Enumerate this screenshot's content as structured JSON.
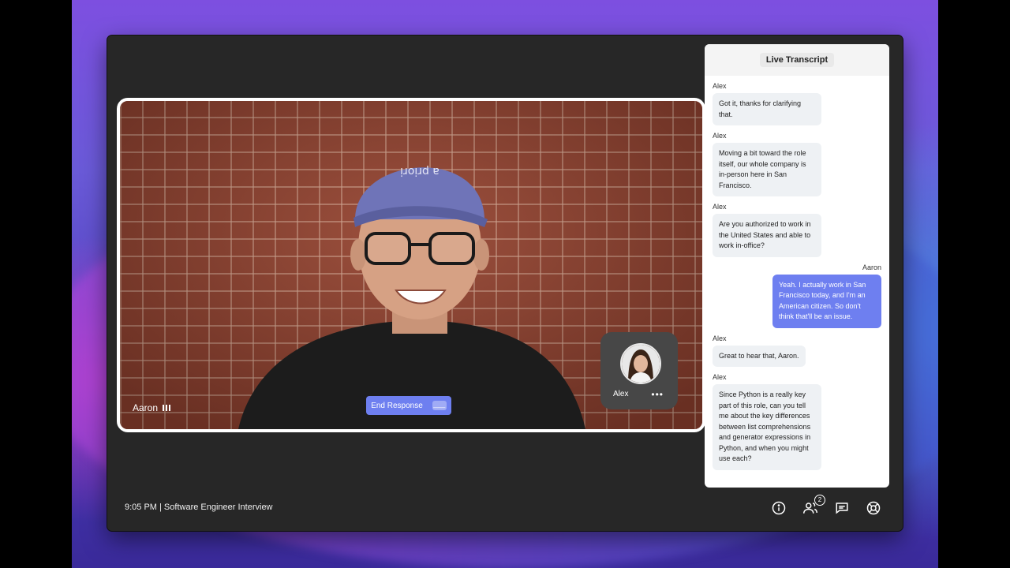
{
  "call": {
    "footer_text": "9:05 PM | Software Engineer Interview",
    "main_participant": "Aaron",
    "pip_participant": "Alex",
    "end_response_label": "End Response",
    "end_response_key": "___",
    "pip_more": "•••"
  },
  "transcript": {
    "title": "Live Transcript",
    "messages": [
      {
        "speaker": "Alex",
        "text": "Got it, thanks for clarifying that.",
        "side": "left"
      },
      {
        "speaker": "Alex",
        "text": "Moving a bit toward the role itself, our whole company is in-person here in San Francisco.",
        "side": "left"
      },
      {
        "speaker": "Alex",
        "text": "Are you authorized to work in the United States and able to work in-office?",
        "side": "left"
      },
      {
        "speaker": "Aaron",
        "text": "Yeah. I actually work in San Francisco today, and I'm an American citizen. So don't think that'll be an issue.",
        "side": "right"
      },
      {
        "speaker": "Alex",
        "text": "Great to hear that, Aaron.",
        "side": "left"
      },
      {
        "speaker": "Alex",
        "text": "Since Python is a really key part of this role, can you tell me about the key differences between list comprehensions and generator expressions in Python, and when you might use each?",
        "side": "left"
      }
    ]
  },
  "toolbar": {
    "participants_count": "2",
    "icons": [
      "info-icon",
      "participants-icon",
      "chat-icon",
      "settings-icon"
    ]
  },
  "colors": {
    "accent": "#6e7ff0",
    "window_bg": "#272727",
    "bubble_bg": "#eef1f4"
  }
}
